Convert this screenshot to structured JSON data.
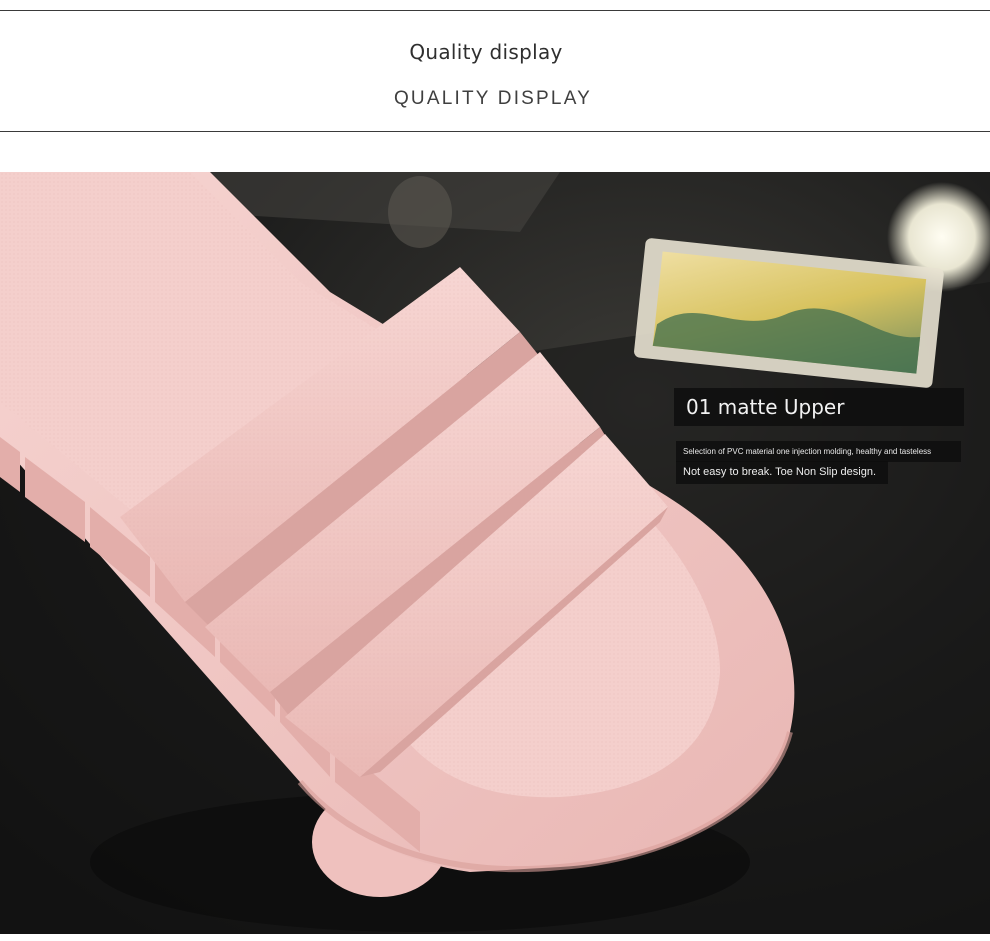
{
  "header": {
    "title": "Quality display",
    "subtitle": "QUALITY DISPLAY"
  },
  "feature": {
    "title": "01 matte Upper",
    "line1": "Selection of PVC material one injection molding, healthy and tasteless",
    "line2": "Not easy to break. Toe Non Slip design."
  },
  "colors": {
    "slipper_pink": "#f2c9c7",
    "background_dark": "#1b1b1b",
    "rule": "#3a3a3a"
  }
}
